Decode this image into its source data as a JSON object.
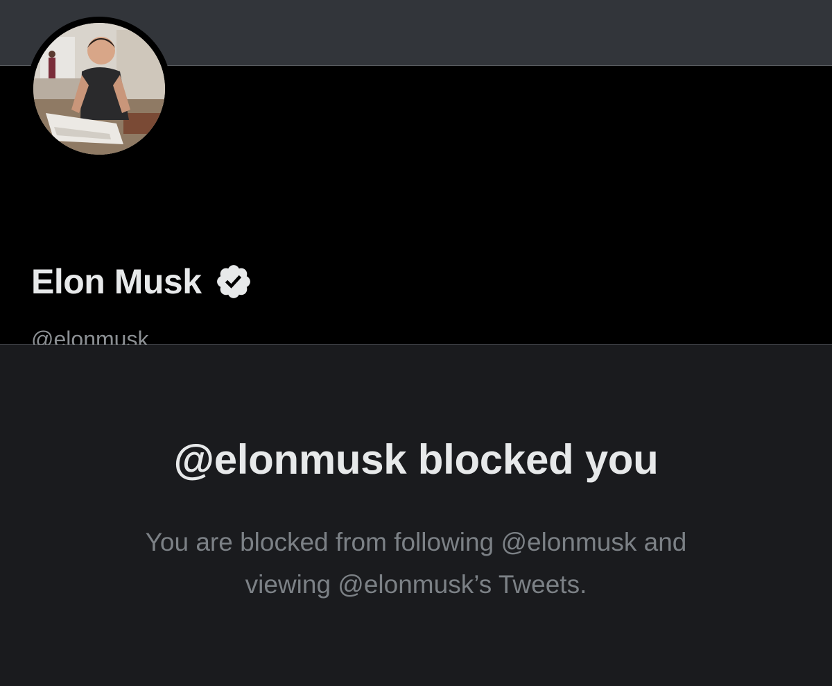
{
  "banner": {
    "color": "#32353a"
  },
  "profile": {
    "avatar_icon": "profile-photo",
    "display_name": "Elon Musk",
    "verified_icon": "verified-badge-icon",
    "handle": "@elonmusk"
  },
  "blocked": {
    "title": "@elonmusk blocked you",
    "description": "You are blocked from following @elonmusk and viewing @elonmusk’s Tweets."
  },
  "colors": {
    "background": "#000000",
    "blocked_panel": "#1a1b1e",
    "primary_text": "#e7e9ea",
    "secondary_text": "#8b8f93"
  }
}
